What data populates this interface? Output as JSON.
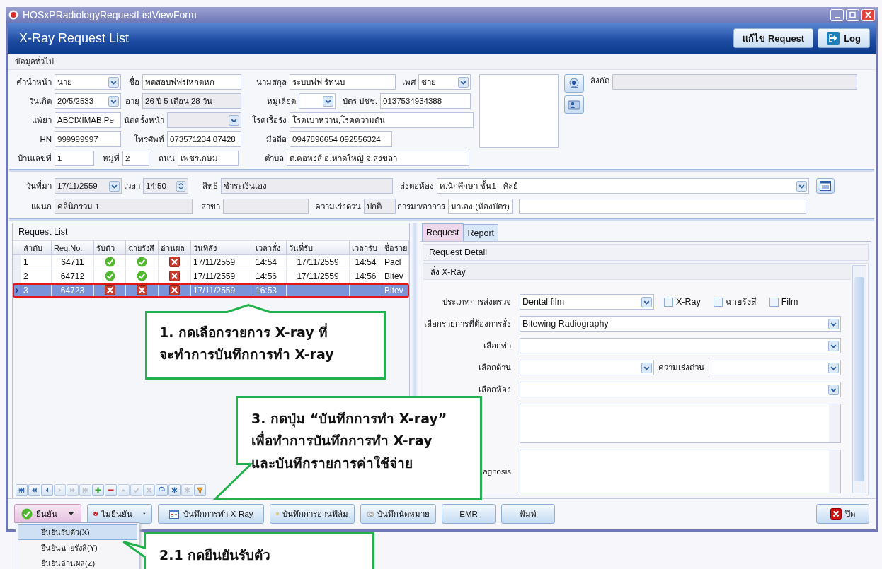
{
  "window": {
    "title": "HOSxPRadiologyRequestListViewForm"
  },
  "header": {
    "title": "X-Ray Request List",
    "buttons": [
      {
        "label": "แก้ไข Request",
        "kind": "edit"
      },
      {
        "label": "Log",
        "kind": "log"
      }
    ]
  },
  "section": "ข้อมูลทั่วไป",
  "patient_rows": [
    [
      {
        "label": "คำนำหน้า",
        "value": "นาย",
        "kind": "combo",
        "readonly": false
      },
      {
        "label": "ชื่อ",
        "value": "ทดสอบฟฟรfหกดหก",
        "kind": "text",
        "readonly": false
      },
      {
        "label": "นามสกุล",
        "value": "ระบบฟฟ รัทนบ",
        "kind": "text",
        "readonly": false
      },
      {
        "label": "เพศ",
        "value": "ชาย",
        "kind": "combo",
        "readonly": false
      }
    ],
    [
      {
        "label": "วันเกิด",
        "value": "20/5/2533",
        "kind": "combo",
        "readonly": false
      },
      {
        "label": "อายุ",
        "value": "26 ปี 5 เดือน 28 วัน",
        "kind": "text",
        "readonly": true
      },
      {
        "label": "หมู่เลือด",
        "kind": "combo",
        "readonly": false
      },
      {
        "label": "บัตร ปชช.",
        "value": "0137534934388",
        "kind": "text",
        "readonly": false
      }
    ],
    [
      {
        "label": "แพ้ยา",
        "value": "ABCIXIMAB,Pe",
        "kind": "text",
        "readonly": false
      },
      {
        "label": "นัดครั้งหน้า",
        "kind": "combo",
        "readonly": true
      },
      {
        "label": "โรคเรื้อรัง",
        "value": "โรคเบาหวาน,โรคความดัน",
        "kind": "text",
        "readonly": false
      }
    ],
    [
      {
        "label": "HN",
        "value": "999999997",
        "kind": "text",
        "readonly": false
      },
      {
        "label": "โทรศัพท์",
        "value": "073571234 07428",
        "kind": "text",
        "readonly": false
      },
      {
        "label": "มือถือ",
        "value": "0947896654 092556324",
        "kind": "text",
        "readonly": false
      }
    ],
    [
      {
        "label": "บ้านเลขที่",
        "value": "1",
        "kind": "text",
        "readonly": false
      },
      {
        "label": "หมู่ที่",
        "value": "2",
        "kind": "text",
        "readonly": false
      },
      {
        "label": "ถนน",
        "value": "เพชรเกษม",
        "kind": "text",
        "readonly": false
      },
      {
        "label": "ตำบล",
        "value": "ต.คอหงส์ อ.หาดใหญ่ จ.สงขลา",
        "kind": "text",
        "readonly": false
      }
    ]
  ],
  "affiliation": {
    "label": "สังกัด",
    "readonly": true
  },
  "visit_rows": [
    [
      {
        "label": "วันที่มา",
        "value": "17/11/2559",
        "kind": "combo",
        "readonly": true
      },
      {
        "label": "เวลา",
        "value": "14:50",
        "kind": "spin",
        "readonly": true
      },
      {
        "label": "สิทธิ",
        "value": "ชำระเงินเอง",
        "kind": "text",
        "readonly": true
      },
      {
        "label": "ส่งต่อห้อง",
        "value": "ค.นักศึกษา ชั้น1 - ศัลย์",
        "kind": "combo",
        "readonly": false
      }
    ],
    [
      {
        "label": "แผนก",
        "value": "คลินิกรวม 1",
        "kind": "text",
        "readonly": true
      },
      {
        "label": "สาขา",
        "kind": "text",
        "readonly": true
      },
      {
        "label": "ความเร่งด่วน",
        "value": "ปกติ",
        "kind": "text",
        "readonly": true
      },
      {
        "label": "การมา/อาการ",
        "value": "มาเอง (ห้องบัตร)",
        "kind": "text",
        "readonly": false
      },
      {
        "kind": "text",
        "readonly": false
      }
    ]
  ],
  "request_list": {
    "title": "Request List",
    "columns": [
      "ลำดับ",
      "Req.No.",
      "รับตัว",
      "ฉายรังสี",
      "อ่านผล",
      "วันที่สั่ง",
      "เวลาสั่ง",
      "วันที่รับ",
      "เวลารับ",
      "ชื่อราย"
    ],
    "rows": [
      {
        "selected": false,
        "no": "1",
        "req_no": "64711",
        "received": true,
        "xrayed": true,
        "result_read": false,
        "order_date": "17/11/2559",
        "order_time": "14:54",
        "receive_date": "17/11/2559",
        "receive_time": "14:54",
        "name": "Pacl"
      },
      {
        "selected": false,
        "no": "2",
        "req_no": "64712",
        "received": true,
        "xrayed": true,
        "result_read": false,
        "order_date": "17/11/2559",
        "order_time": "14:56",
        "receive_date": "17/11/2559",
        "receive_time": "14:56",
        "name": "Bitev"
      },
      {
        "selected": true,
        "no": "3",
        "req_no": "64723",
        "received": false,
        "xrayed": false,
        "result_read": false,
        "order_date": "17/11/2559",
        "order_time": "16:53",
        "name": "Bitev"
      }
    ],
    "navigator": [
      {
        "kind": "first",
        "disabled": false
      },
      {
        "kind": "prev_page",
        "disabled": false
      },
      {
        "kind": "prev",
        "disabled": false
      },
      {
        "kind": "next",
        "disabled": true
      },
      {
        "kind": "next_page",
        "disabled": true
      },
      {
        "kind": "last",
        "disabled": true
      },
      {
        "kind": "add",
        "disabled": false
      },
      {
        "kind": "delete",
        "disabled": false
      },
      {
        "kind": "up",
        "disabled": true
      },
      {
        "kind": "check",
        "disabled": true
      },
      {
        "kind": "cancel",
        "disabled": true
      },
      {
        "kind": "refresh",
        "disabled": false
      },
      {
        "kind": "star",
        "disabled": false
      },
      {
        "kind": "star",
        "disabled": true
      },
      {
        "kind": "filter",
        "disabled": false
      }
    ]
  },
  "tabs": [
    {
      "label": "Request",
      "selected": true
    },
    {
      "label": "Report",
      "selected": false
    }
  ],
  "request_detail": {
    "title": "Request Detail",
    "group": "สั่ง X-Ray",
    "rows": [
      [
        {
          "kind": "combo",
          "label": "ประเภทการส่งตรวจ",
          "value": "Dental film"
        },
        {
          "kind": "checkbox",
          "label": "X-Ray",
          "checked": false
        },
        {
          "kind": "checkbox",
          "label": "ฉายรังสี",
          "checked": false
        },
        {
          "kind": "checkbox",
          "label": "Film",
          "checked": false
        }
      ],
      [
        {
          "kind": "combo",
          "label": "เลือกรายการที่ต้องการสั่ง",
          "value": "Bitewing Radiography"
        }
      ],
      [
        {
          "kind": "combo",
          "label": "เลือกท่า"
        }
      ],
      [
        {
          "kind": "combo",
          "label": "เลือกด้าน"
        },
        {
          "kind": "combo",
          "label": "ความเร่งด่วน"
        }
      ],
      [
        {
          "kind": "combo",
          "label": "เลือกห้อง"
        }
      ],
      [
        {
          "kind": "memo"
        }
      ],
      [
        {
          "kind": "memo",
          "label": "agnosis"
        }
      ]
    ]
  },
  "actions": [
    {
      "label": "ยืนยัน",
      "kind": "confirm",
      "expanded": true
    },
    {
      "label": "ไม่ยืนยัน",
      "kind": "reject",
      "expanded": false
    },
    {
      "label": "บันทึกการทำ X-Ray",
      "kind": "record",
      "expanded": false
    },
    {
      "label": "บันทึกการอ่านฟิล์ม",
      "kind": "read",
      "expanded": false
    },
    {
      "label": "บันทึกนัดหมาย",
      "kind": "appointment",
      "expanded": false
    },
    {
      "label": "EMR",
      "kind": "plain",
      "expanded": false
    },
    {
      "label": "พิมพ์",
      "kind": "plain",
      "expanded": false
    },
    {
      "label": "ปิด",
      "kind": "close",
      "expanded": false
    }
  ],
  "menu": [
    {
      "label": "ยืนยันรับตัว(X)",
      "selected": true
    },
    {
      "label": "ยืนยันฉายรังสี(Y)",
      "selected": false
    },
    {
      "label": "ยืนยันอ่านผล(Z)",
      "selected": false
    }
  ],
  "callouts": [
    {
      "text": "1. กดเลือกรายการ X-ray ที่\nจะทำการบันทึกการทำ X-ray"
    },
    {
      "text": "3. กดปุ่ม “บันทึกการทำ X-ray”\nเพื่อทำการบันทึกการทำ X-ray\nและบันทึกรายการค่าใช้จ่าย"
    },
    {
      "text": "2.1 กดยืนยันรับตัว"
    }
  ]
}
